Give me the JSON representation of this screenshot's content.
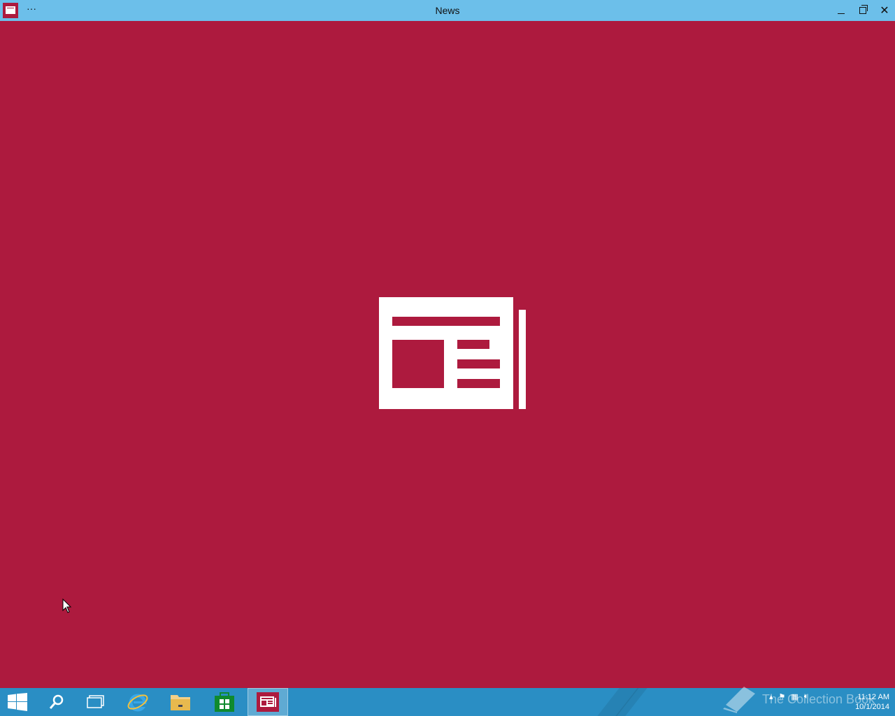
{
  "window": {
    "title": "News",
    "menu_label": "···",
    "controls": {
      "minimize": "minimize",
      "maximize": "maximize",
      "close": "✕"
    }
  },
  "taskbar": {
    "items": [
      {
        "name": "start-button",
        "icon": "windows-logo-icon"
      },
      {
        "name": "search-button",
        "icon": "search-icon"
      },
      {
        "name": "task-view-button",
        "icon": "task-view-icon"
      },
      {
        "name": "internet-explorer-button",
        "icon": "ie-icon"
      },
      {
        "name": "file-explorer-button",
        "icon": "folder-icon"
      },
      {
        "name": "store-button",
        "icon": "store-icon"
      },
      {
        "name": "news-app-button",
        "icon": "news-icon",
        "active": true
      }
    ],
    "clock": {
      "time": "11:12 AM",
      "date": "10/1/2014"
    },
    "watermark": "The Collection Book"
  },
  "colors": {
    "accent": "#ad1a3e",
    "titlebar": "#6cbfea",
    "taskbar": "#2a8ec4"
  }
}
